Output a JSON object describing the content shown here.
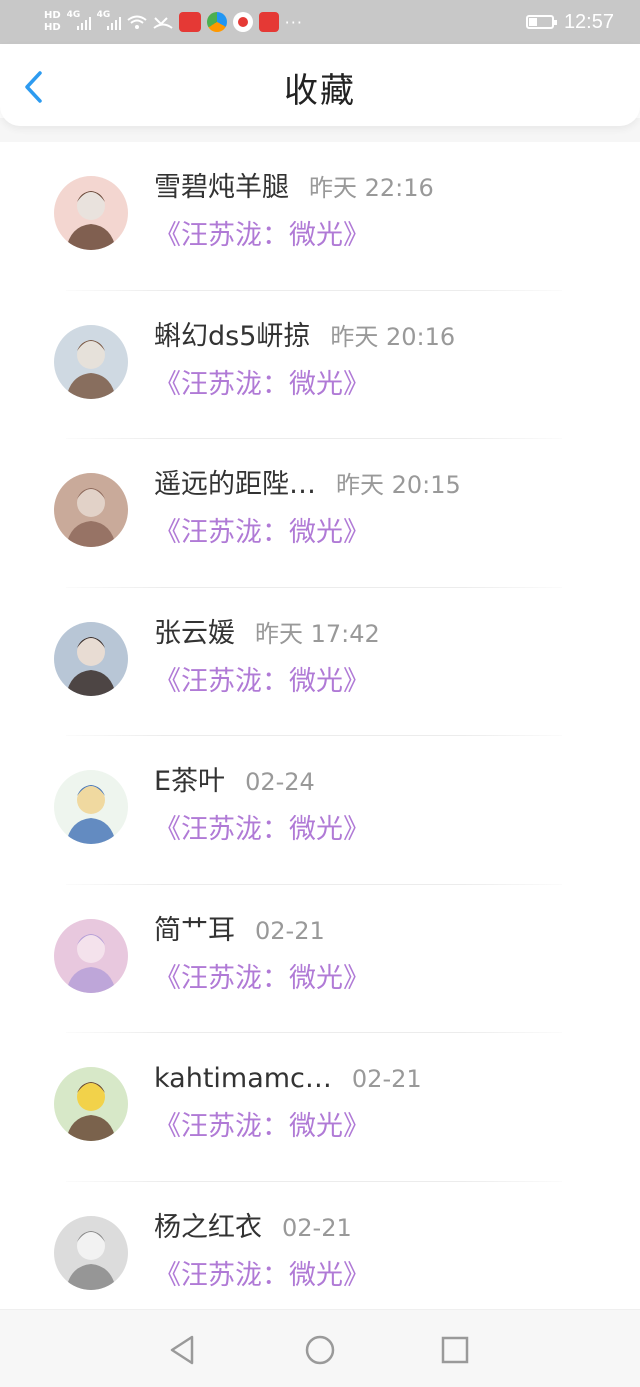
{
  "status_bar": {
    "network_label_1": "HD",
    "network_label_2": "HD",
    "signal_1": "4G",
    "signal_2": "4G",
    "dots": "···",
    "time": "12:57",
    "battery_level": 0.35
  },
  "header": {
    "title": "收藏",
    "back_icon": "chevron-left-icon"
  },
  "favorites": [
    {
      "name": "雪碧炖羊腿",
      "time": "昨天 22:16",
      "title": "《汪苏泷：微光》"
    },
    {
      "name": "蝌幻ds5岍掠",
      "time": "昨天 20:16",
      "title": "《汪苏泷：微光》"
    },
    {
      "name": "遥远的距陛…",
      "time": "昨天 20:15",
      "title": "《汪苏泷：微光》"
    },
    {
      "name": "张云媛",
      "time": "昨天 17:42",
      "title": "《汪苏泷：微光》"
    },
    {
      "name": "E茶叶",
      "time": "02-24",
      "title": "《汪苏泷：微光》"
    },
    {
      "name": "简艹耳",
      "time": "02-21",
      "title": "《汪苏泷：微光》"
    },
    {
      "name": "kahtimamc…",
      "time": "02-21",
      "title": "《汪苏泷：微光》"
    },
    {
      "name": "杨之红衣",
      "time": "02-21",
      "title": "《汪苏泷：微光》"
    }
  ],
  "nav": {
    "back_icon": "triangle-back-icon",
    "home_icon": "circle-home-icon",
    "recents_icon": "square-recents-icon"
  },
  "colors": {
    "accent_blue": "#2d9bf0",
    "title_purple": "#b07ad6",
    "status_bar_bg": "#c8c8c8"
  }
}
